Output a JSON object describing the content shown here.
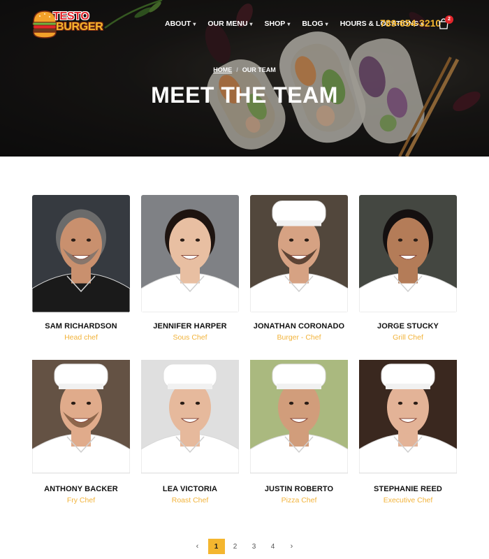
{
  "brand": {
    "line1": "TESTO",
    "line2": "BURGER"
  },
  "nav": {
    "items": [
      {
        "label": "ABOUT",
        "name": "nav-about"
      },
      {
        "label": "OUR MENU",
        "name": "nav-our-menu"
      },
      {
        "label": "SHOP",
        "name": "nav-shop"
      },
      {
        "label": "BLOG",
        "name": "nav-blog"
      },
      {
        "label": "HOURS & LOCATIONS",
        "name": "nav-hours-locations"
      }
    ],
    "chevron": "⌄",
    "phone": "789-654-3210",
    "cart_count": "2",
    "cart_icon": "shopping-bag-icon"
  },
  "breadcrumb": {
    "home": "HOME",
    "separator": "/",
    "current": "OUR TEAM"
  },
  "page_title": "MEET THE TEAM",
  "team": [
    {
      "name": "SAM RICHARDSON",
      "role": "Head chef",
      "skin": "#c9906e",
      "hair": "#6b6b6b",
      "hat": false,
      "beard": true,
      "bg": "#3b3f46",
      "coat": "#1a1a1a"
    },
    {
      "name": "JENNIFER HARPER",
      "role": "Sous Chef",
      "skin": "#e8bfa2",
      "hair": "#1e1410",
      "hat": false,
      "beard": false,
      "bg": "#8a8d91",
      "coat": "#ffffff"
    },
    {
      "name": "JONATHAN CORONADO",
      "role": "Burger - Chef",
      "skin": "#d6a283",
      "hair": "#2a1c14",
      "hat": true,
      "beard": true,
      "bg": "#5a4e42",
      "coat": "#ffffff"
    },
    {
      "name": "JORGE STUCKY",
      "role": "Grill Chef",
      "skin": "#b47c58",
      "hair": "#141010",
      "hat": false,
      "beard": false,
      "bg": "#4a4e47",
      "coat": "#ffffff"
    },
    {
      "name": "ANTHONY BACKER",
      "role": "Fry Chef",
      "skin": "#e0ab8b",
      "hair": "#6b4a32",
      "hat": true,
      "beard": true,
      "bg": "#6d5a4a",
      "coat": "#ffffff"
    },
    {
      "name": "LEA VICTORIA",
      "role": "Roast Chef",
      "skin": "#e6b99c",
      "hair": "#3a2418",
      "hat": true,
      "beard": false,
      "bg": "#f2f2f2",
      "coat": "#ffffff"
    },
    {
      "name": "JUSTIN ROBERTO",
      "role": "Pizza Chef",
      "skin": "#d19d7b",
      "hair": "#2b1d14",
      "hat": true,
      "beard": false,
      "bg": "#b9c98a",
      "coat": "#ffffff"
    },
    {
      "name": "STEPHANIE REED",
      "role": "Executive Chef",
      "skin": "#e3b397",
      "hair": "#8b5a34",
      "hat": true,
      "beard": false,
      "bg": "#3f2c22",
      "coat": "#ffffff"
    }
  ],
  "pagination": {
    "prev": "‹",
    "next": "›",
    "pages": [
      "1",
      "2",
      "3",
      "4"
    ],
    "active": "1"
  },
  "colors": {
    "accent": "#f4b62f",
    "brand_red": "#e2262b",
    "hero_bg": "#1d1b19"
  }
}
